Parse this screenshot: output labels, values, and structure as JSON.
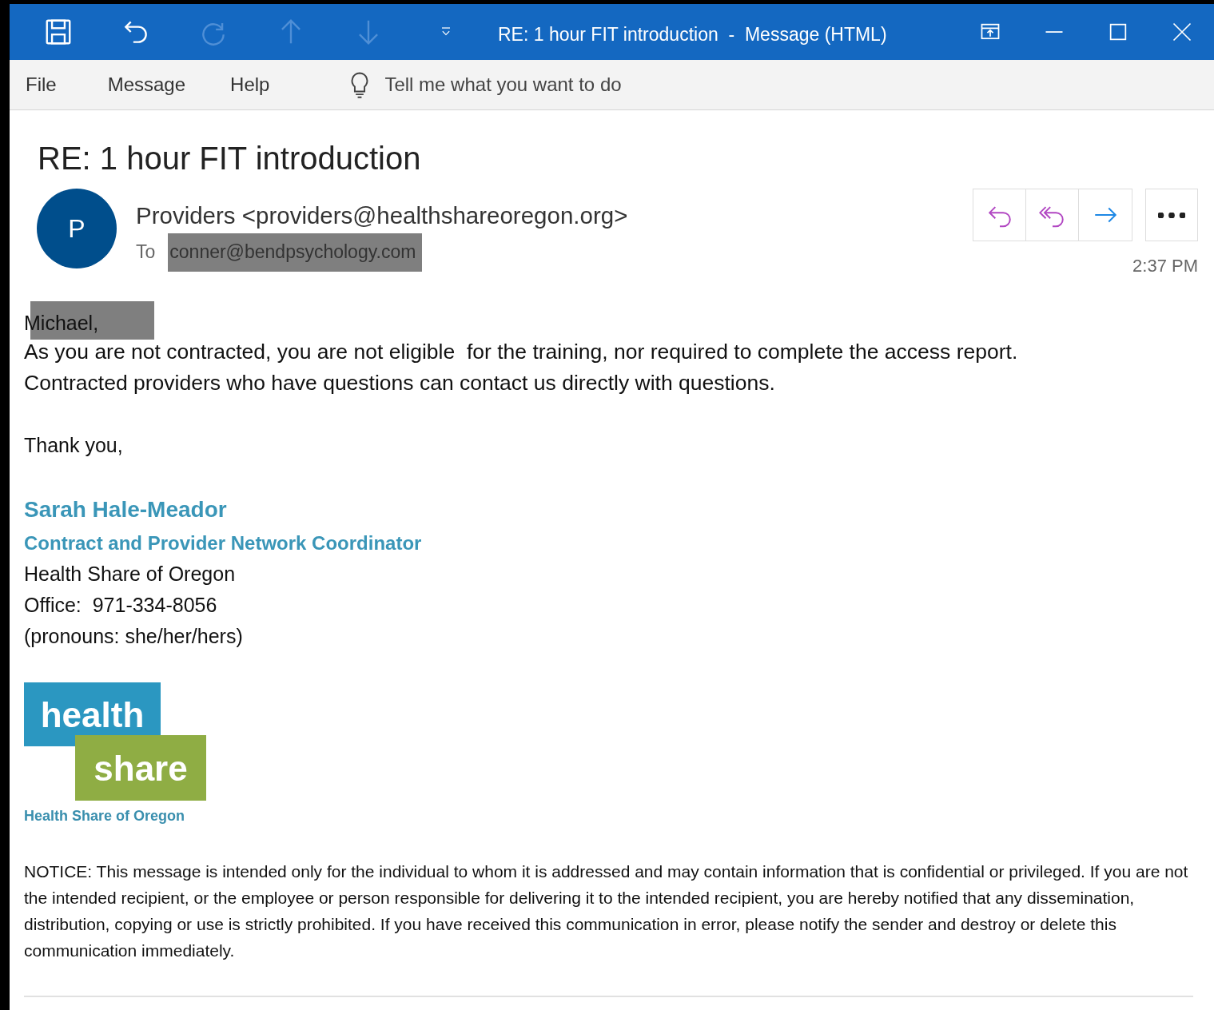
{
  "window": {
    "title": "RE: 1 hour FIT introduction  -  Message (HTML)"
  },
  "quick_access": [
    {
      "kind": "save",
      "disabled": false
    },
    {
      "kind": "undo",
      "disabled": false
    },
    {
      "kind": "redo",
      "disabled": true
    },
    {
      "kind": "up",
      "disabled": true
    },
    {
      "kind": "down",
      "disabled": true
    },
    {
      "kind": "customize",
      "disabled": false
    }
  ],
  "window_controls": [
    {
      "kind": "ribbon"
    },
    {
      "kind": "minimize"
    },
    {
      "kind": "maximize"
    },
    {
      "kind": "close"
    }
  ],
  "menu": [
    "File",
    "Message",
    "Help"
  ],
  "tell_me": {
    "placeholder": "Tell me what you want to do"
  },
  "message": {
    "subject": "RE: 1 hour FIT introduction",
    "avatar": "P",
    "from": "Providers <providers@healthshareoregon.org>",
    "to_label": "To",
    "to": "conner@bendpsychology.com",
    "to_redacted": true,
    "time": "2:37 PM",
    "actions": [
      {
        "kind": "reply"
      },
      {
        "kind": "reply_all"
      },
      {
        "kind": "forward"
      },
      {
        "kind": "more"
      }
    ]
  },
  "body": {
    "greeting": "Michael,",
    "greeting_redacted": true,
    "lines": [
      "As you are not contracted, you are not eligible  for the training, nor required to complete the access report.",
      "Contracted providers who have questions can contact us directly with questions."
    ],
    "closing": "Thank you,",
    "signature": {
      "name": "Sarah Hale-Meador",
      "title": "Contract and Provider Network Coordinator",
      "lines": [
        "Health Share of Oregon",
        "Office:  971-334-8056",
        "(pronouns: she/her/hers)"
      ]
    },
    "logo": {
      "word_1": "health",
      "word_2": "share",
      "caption": "Health Share of Oregon"
    },
    "notice": "NOTICE: This message is intended only for the individual to whom it is addressed and may contain information that is confidential or privileged. If you are not the intended recipient, or the employee or person responsible for delivering it to the intended recipient, you are hereby notified that any dissemination, distribution, copying or use is strictly prohibited. If you have received this communication in error, please notify the sender and destroy or delete this communication immediately."
  }
}
